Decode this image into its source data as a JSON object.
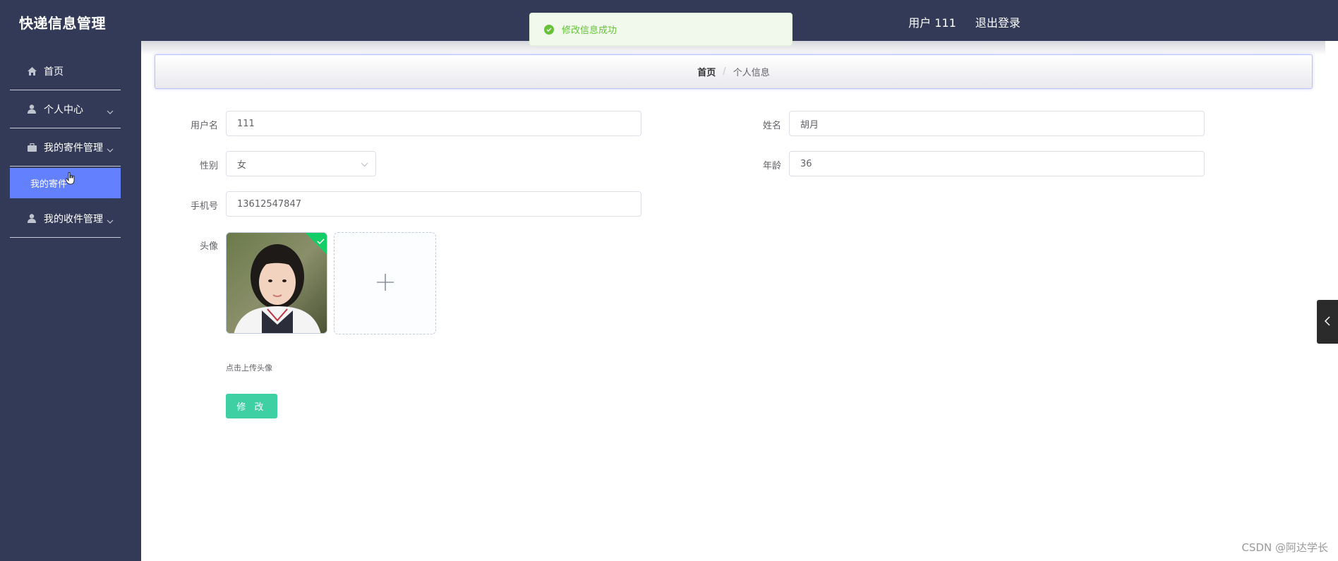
{
  "app": {
    "title": "快递信息管理"
  },
  "header": {
    "user_label": "用户 111",
    "logout_label": "退出登录"
  },
  "toast": {
    "message": "修改信息成功"
  },
  "sidebar": {
    "items": [
      {
        "label": "首页",
        "icon": "home-icon"
      },
      {
        "label": "个人中心",
        "icon": "user-icon"
      },
      {
        "label": "我的寄件管理",
        "icon": "briefcase-icon"
      },
      {
        "label": "我的收件管理",
        "icon": "user-icon"
      }
    ],
    "active_subitem": {
      "label": "我的寄件"
    }
  },
  "breadcrumb": {
    "home": "首页",
    "separator": "/",
    "current": "个人信息"
  },
  "form": {
    "username": {
      "label": "用户名",
      "value": "111"
    },
    "name": {
      "label": "姓名",
      "value": "胡月"
    },
    "gender": {
      "label": "性别",
      "value": "女"
    },
    "age": {
      "label": "年龄",
      "value": "36"
    },
    "phone": {
      "label": "手机号",
      "value": "13612547847"
    },
    "avatar": {
      "label": "头像",
      "hint": "点击上传头像"
    },
    "submit_label": "修 改"
  },
  "watermark": "CSDN @阿达学长",
  "colors": {
    "sidebar_bg": "#333a57",
    "accent": "#6380ff",
    "success": "#67c23a",
    "submit": "#3ecfa3"
  }
}
